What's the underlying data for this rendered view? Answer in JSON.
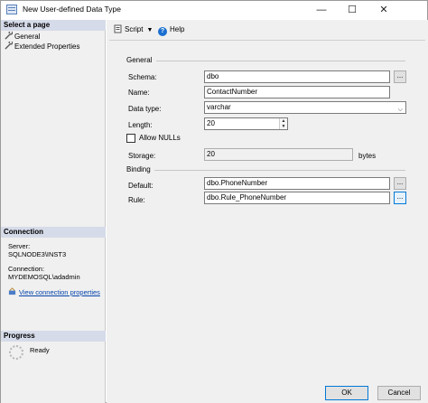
{
  "window": {
    "title": "New User-defined Data Type",
    "controls": {
      "minimize": "—",
      "maximize": "☐",
      "close": "✕"
    }
  },
  "sidebar": {
    "select_page_header": "Select a page",
    "pages": [
      {
        "label": "General",
        "icon": "wrench-icon"
      },
      {
        "label": "Extended Properties",
        "icon": "wrench-icon"
      }
    ],
    "connection_header": "Connection",
    "server_label": "Server:",
    "server_value": "SQLNODE3\\INST3",
    "connection_label": "Connection:",
    "connection_value": "MYDEMOSQL\\adadmin",
    "view_properties_link": "View connection properties",
    "progress_header": "Progress",
    "progress_status": "Ready"
  },
  "toolbar": {
    "script_label": "Script",
    "help_label": "Help"
  },
  "form": {
    "general_group": "General",
    "schema_label": "Schema:",
    "schema_value": "dbo",
    "name_label": "Name:",
    "name_value": "ContactNumber",
    "data_type_label": "Data type:",
    "data_type_value": "varchar",
    "length_label": "Length:",
    "length_value": "20",
    "allow_nulls_label": "Allow NULLs",
    "allow_nulls_checked": false,
    "storage_label": "Storage:",
    "storage_value": "20",
    "storage_unit": "bytes",
    "binding_group": "Binding",
    "default_label": "Default:",
    "default_value": "dbo.PhoneNumber",
    "rule_label": "Rule:",
    "rule_value": "dbo.Rule_PhoneNumber",
    "ellipsis": "..."
  },
  "footer": {
    "ok_label": "OK",
    "cancel_label": "Cancel"
  },
  "colors": {
    "section_header": "#d6dbe9",
    "panel": "#f0f0f0",
    "link": "#0645ad",
    "accent": "#0078d7"
  }
}
